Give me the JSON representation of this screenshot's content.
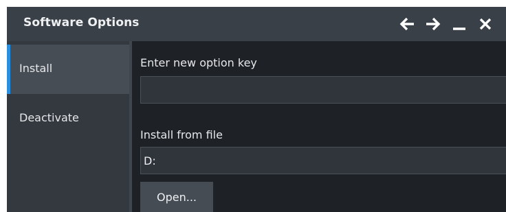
{
  "window": {
    "title": "Software Options",
    "controls": {
      "back_icon": "arrow-left-icon",
      "forward_icon": "arrow-right-icon",
      "minimize_icon": "minimize-icon",
      "close_icon": "close-icon"
    }
  },
  "sidebar": {
    "items": [
      {
        "label": "Install",
        "active": true
      },
      {
        "label": "Deactivate",
        "active": false
      }
    ]
  },
  "main": {
    "option_key": {
      "label": "Enter new option key",
      "value": ""
    },
    "install_file": {
      "label": "Install from file",
      "value": "D:"
    },
    "open_button": "Open..."
  },
  "colors": {
    "accent": "#2b8fe0",
    "titlebar": "#3a4048",
    "background": "#1e2226"
  }
}
